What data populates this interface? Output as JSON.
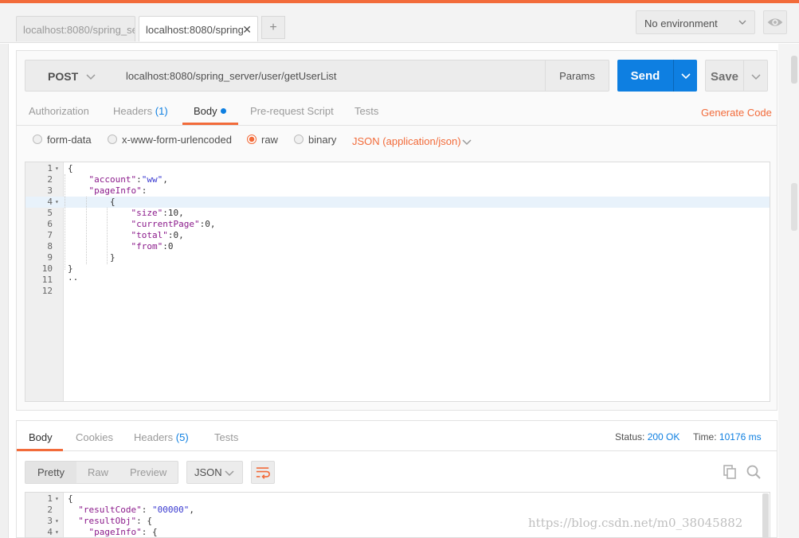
{
  "tabs": [
    {
      "label": "localhost:8080/spring_se",
      "active": false
    },
    {
      "label": "localhost:8080/spring",
      "active": true
    }
  ],
  "tab_close_glyph": "✕",
  "tab_add_glyph": "+",
  "environment": {
    "selected": "No environment"
  },
  "request": {
    "method": "POST",
    "url": "localhost:8080/spring_server/user/getUserList",
    "params_label": "Params",
    "send_label": "Send",
    "save_label": "Save"
  },
  "request_tabs": {
    "authorization": "Authorization",
    "headers": "Headers",
    "headers_count": "(1)",
    "body": "Body",
    "prerequest": "Pre-request Script",
    "tests": "Tests",
    "generate_code": "Generate Code"
  },
  "body_modes": {
    "form_data": "form-data",
    "urlencoded": "x-www-form-urlencoded",
    "raw": "raw",
    "binary": "binary",
    "selected": "raw",
    "content_type": "JSON (application/json)"
  },
  "request_body_lines": [
    {
      "n": "1",
      "fold": "▾",
      "text": "{"
    },
    {
      "n": "2",
      "fold": "",
      "text": "    \"account\":\"ww\","
    },
    {
      "n": "3",
      "fold": "",
      "text": "    \"pageInfo\":"
    },
    {
      "n": "4",
      "fold": "▾",
      "text": "        {"
    },
    {
      "n": "5",
      "fold": "",
      "text": "            \"size\":10,"
    },
    {
      "n": "6",
      "fold": "",
      "text": "            \"currentPage\":0,"
    },
    {
      "n": "7",
      "fold": "",
      "text": "            \"total\":0,"
    },
    {
      "n": "8",
      "fold": "",
      "text": "            \"from\":0"
    },
    {
      "n": "9",
      "fold": "",
      "text": "        }"
    },
    {
      "n": "10",
      "fold": "",
      "text": "}"
    },
    {
      "n": "11",
      "fold": "",
      "text": "··"
    },
    {
      "n": "12",
      "fold": "",
      "text": ""
    }
  ],
  "response_tabs": {
    "body": "Body",
    "cookies": "Cookies",
    "headers": "Headers",
    "headers_count": "(5)",
    "tests": "Tests"
  },
  "response_status": {
    "status_label": "Status:",
    "status_value": "200 OK",
    "time_label": "Time:",
    "time_value": "10176 ms"
  },
  "response_view": {
    "pretty": "Pretty",
    "raw": "Raw",
    "preview": "Preview",
    "format": "JSON"
  },
  "response_body_lines": [
    {
      "n": "1",
      "fold": "▾",
      "text": "{"
    },
    {
      "n": "2",
      "fold": "",
      "text": "  \"resultCode\": \"00000\","
    },
    {
      "n": "3",
      "fold": "▾",
      "text": "  \"resultObj\": {"
    },
    {
      "n": "4",
      "fold": "▾",
      "text": "    \"pageInfo\": {"
    }
  ],
  "watermark": "https://blog.csdn.net/m0_38045882",
  "colors": {
    "accent": "#f26b3a",
    "primary": "#0e7fe1"
  }
}
